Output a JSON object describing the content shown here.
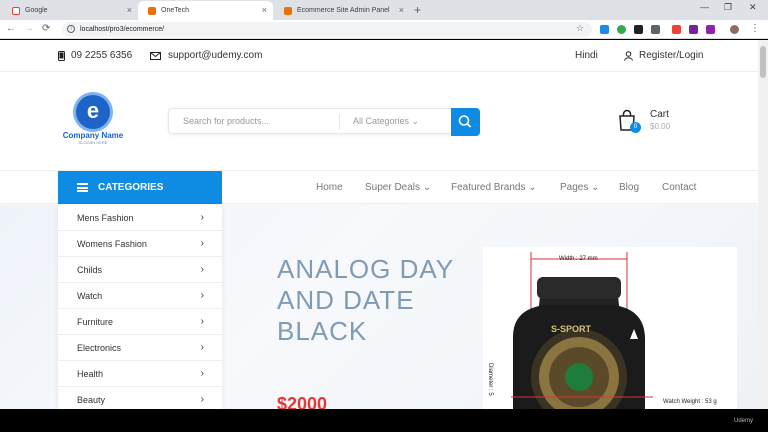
{
  "browser": {
    "tabs": [
      {
        "title": "Google",
        "color": "#ea4335"
      },
      {
        "title": "OneTech",
        "color": "#e8710a"
      },
      {
        "title": "Ecommerce Site Admin Panel",
        "color": "#e8710a"
      }
    ],
    "url": "localhost/pro3/ecommerce/",
    "new_tab_icon": "+"
  },
  "topbar": {
    "phone": "09 2255 6356",
    "email": "support@udemy.com",
    "language": "Hindi",
    "account": "Register/Login"
  },
  "header": {
    "logo_letter": "e",
    "company_name": "Company Name",
    "slogan": "SLOGAN HERE",
    "search_placeholder": "Search for products...",
    "category_select": "All Categories",
    "cart_label": "Cart",
    "cart_count": "0",
    "cart_amount": "$0.00"
  },
  "navbar": {
    "categories_label": "CATEGORIES",
    "menu": [
      "Home",
      "Super Deals",
      "Featured Brands",
      "Pages",
      "Blog",
      "Contact"
    ]
  },
  "sidebar": {
    "items": [
      "Mens Fashion",
      "Womens Fashion",
      "Childs",
      "Watch",
      "Furniture",
      "Electronics",
      "Health",
      "Beauty"
    ]
  },
  "hero": {
    "title": "ANALOG DAY AND DATE BLACK",
    "price": "$2000",
    "watch_brand": "S-SPORT",
    "dim_width": "Width : 27 mm",
    "dim_diameter": "Diameter : 5",
    "dim_weight": "Watch Weight : 53 g"
  },
  "footer": {
    "watermark": "Udemy"
  },
  "colors": {
    "accent": "#0e8ce4",
    "price": "#e53935",
    "headline": "#7f9bb6"
  }
}
